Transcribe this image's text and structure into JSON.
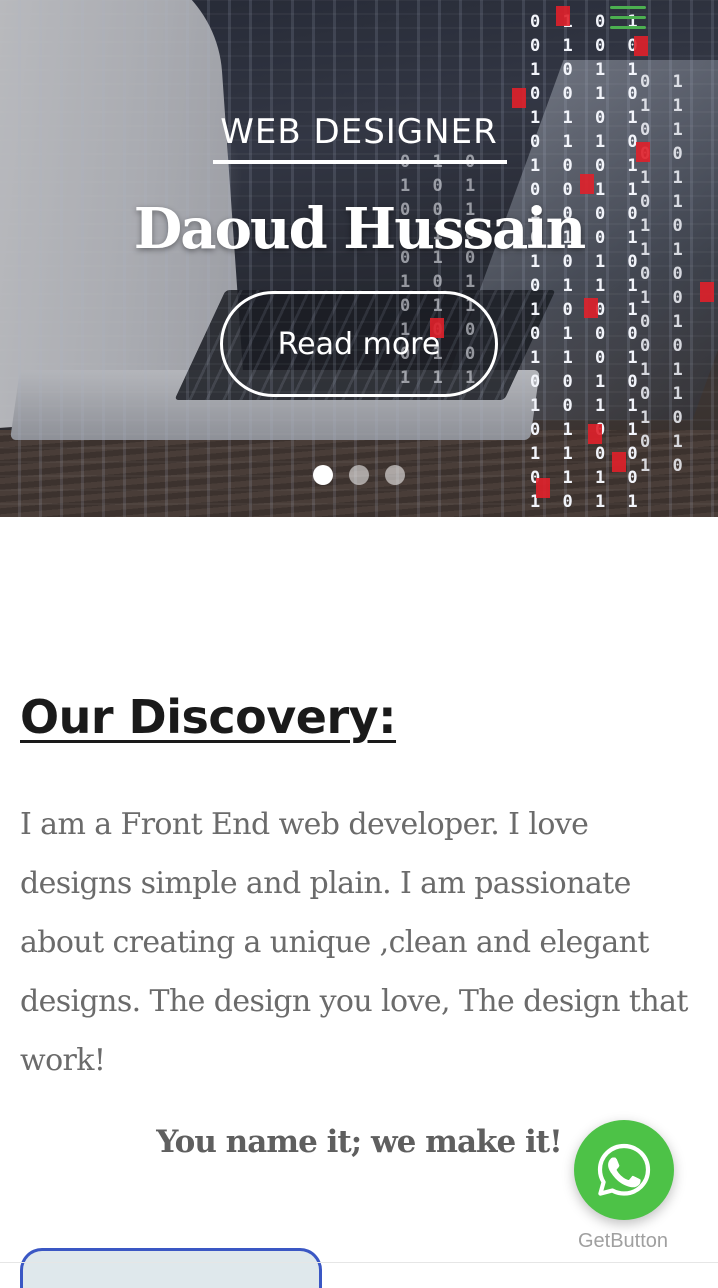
{
  "hero": {
    "subtitle": "WEB DESIGNER",
    "title": "Daoud Hussain",
    "cta_label": "Read more",
    "slide_count": 3,
    "active_slide": 1
  },
  "discovery": {
    "heading": "Our Discovery:",
    "body": "I am a Front End web developer. I love designs simple and plain. I am passionate about creating a unique ,clean and elegant designs. The design you love, The design that work!",
    "tagline": "You name it; we make it!"
  },
  "whatsapp": {
    "label": "GetButton",
    "color": "#4dc247"
  },
  "icons": {
    "menu": "hamburger-menu-icon",
    "whatsapp": "whatsapp-icon"
  },
  "colors": {
    "menu_accent": "#4caf50",
    "heading": "#1a1a1a",
    "body_text": "#6b6b6b",
    "button_border": "#3a57c4"
  }
}
